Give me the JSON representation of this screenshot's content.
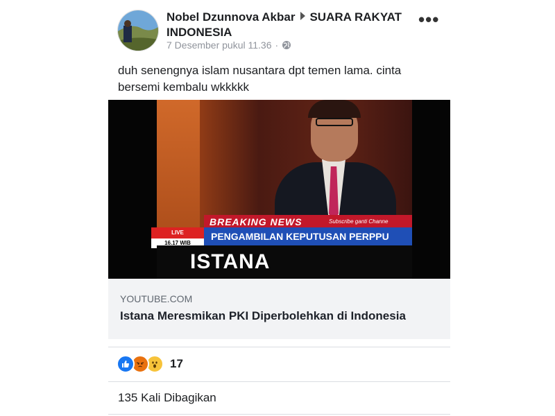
{
  "post": {
    "author": "Nobel Dzunnova Akbar",
    "group": "SUARA RAKYAT INDONESIA",
    "timestamp": "7 Desember pukul 11.36",
    "audience_icon": "globe-icon",
    "menu_icon": "more-options-icon",
    "text": "duh senengnya islam nusantara dpt temen lama. cinta bersemi kembalu wkkkkk"
  },
  "link": {
    "source": "YOUTUBE.COM",
    "title": "Istana Meresmikan PKI Diperbolehkan di Indonesia",
    "video": {
      "breaking_label": "BREAKING NEWS",
      "subscribe_text": "Subscribe ganti Channe",
      "live_label": "LIVE",
      "live_time": "16.17 WIB",
      "ticker_text": "PENGAMBILAN KEPUTUSAN PERPPU ORMAS",
      "caption": "ISTANA MERESMIKAN"
    }
  },
  "engagement": {
    "reactions": [
      "like",
      "angry",
      "wow"
    ],
    "reaction_count": "17",
    "shares": "135 Kali Dibagikan"
  },
  "colors": {
    "like": "#1877f2",
    "angry": "#e9710f",
    "wow": "#f7c33a",
    "breaking": "#c2182a",
    "ticker": "#1f4fb6"
  }
}
